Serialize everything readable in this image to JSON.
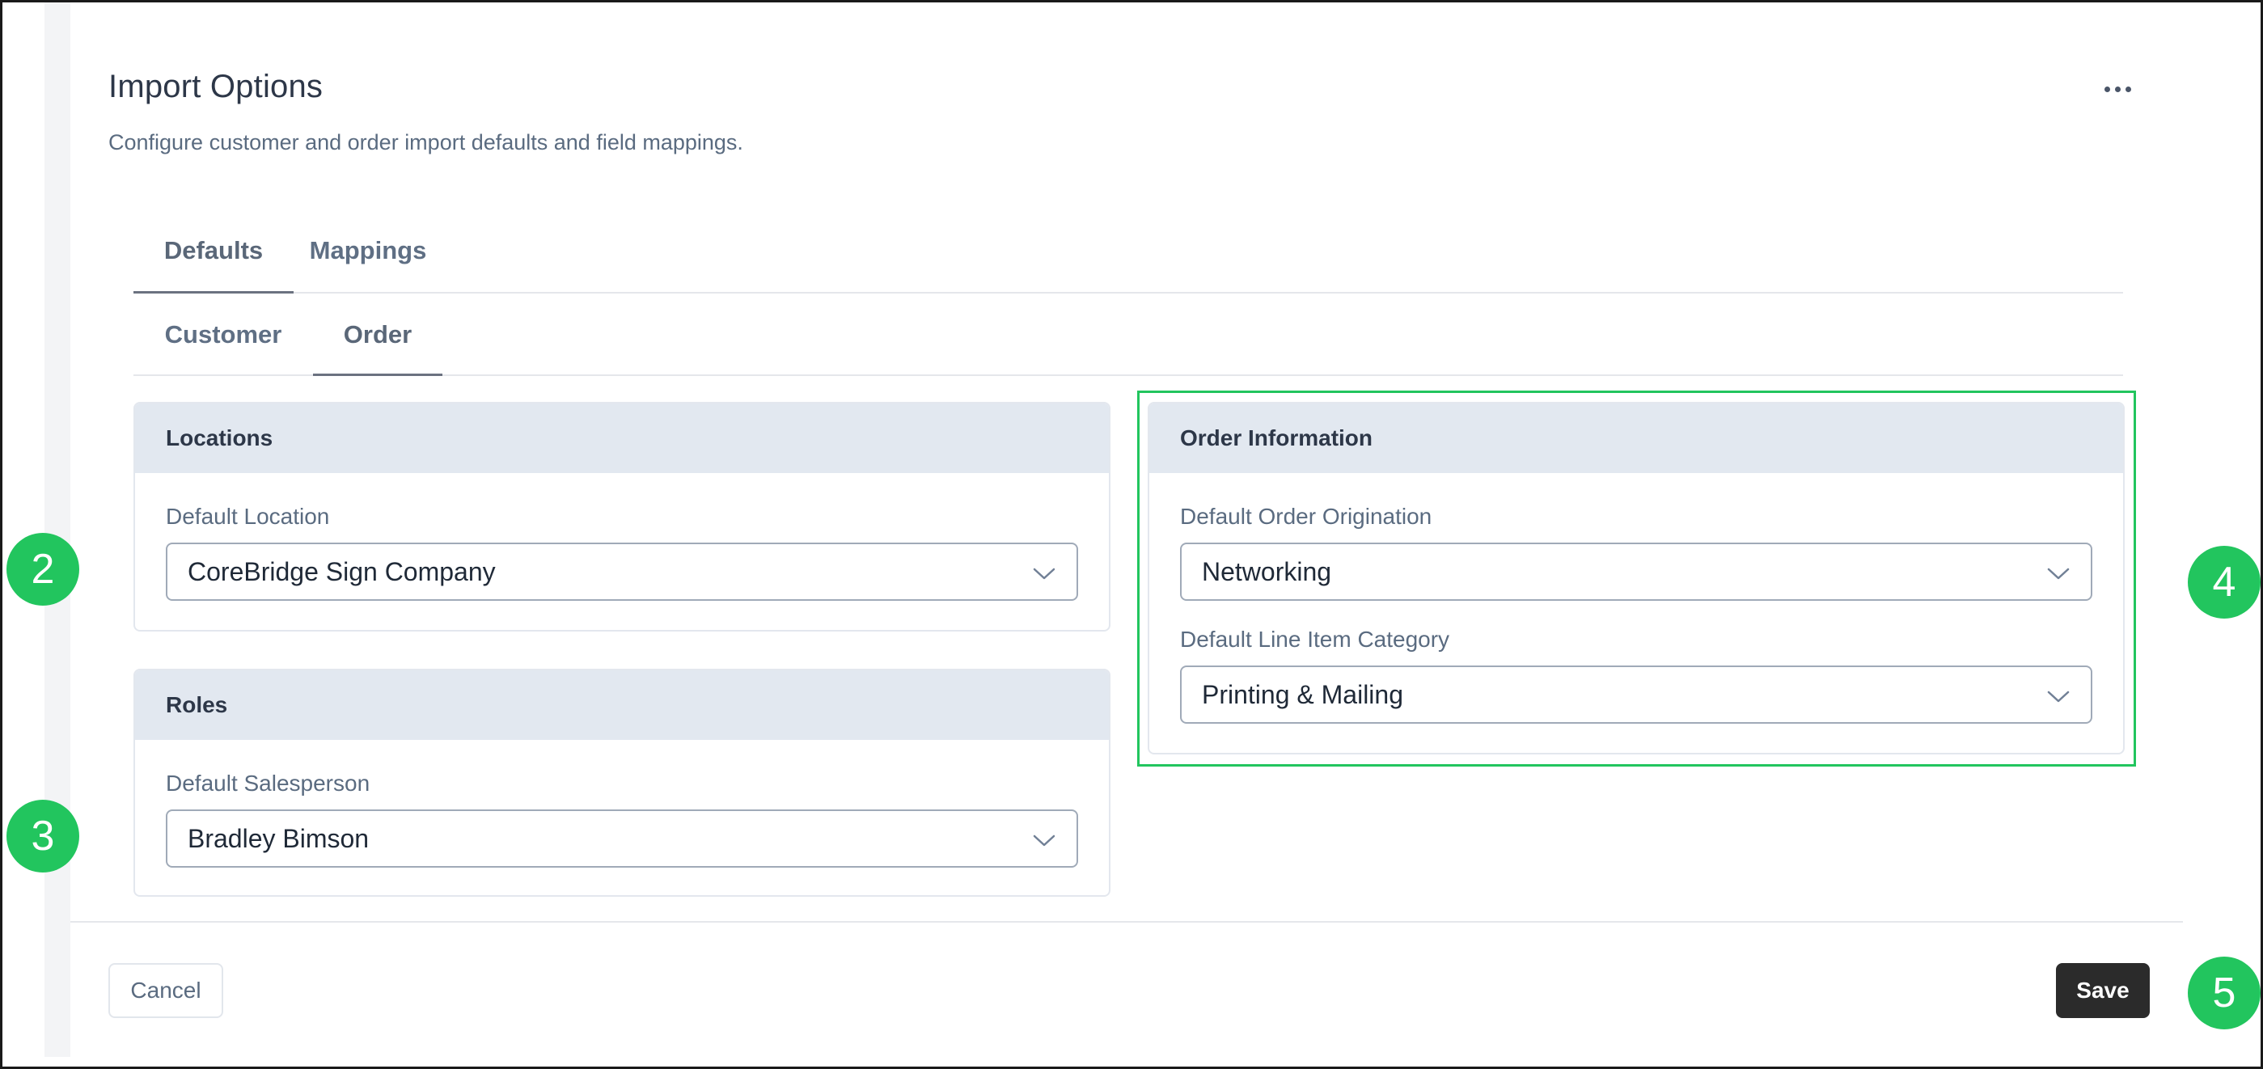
{
  "page": {
    "title": "Import Options",
    "subtitle": "Configure customer and order import defaults and field mappings."
  },
  "tabs_primary": [
    "Defaults",
    "Mappings"
  ],
  "tabs_secondary": [
    "Customer",
    "Order"
  ],
  "active_tabs": {
    "primary": "Defaults",
    "secondary": "Order"
  },
  "locations": {
    "header": "Locations",
    "default_location_label": "Default Location",
    "default_location_value": "CoreBridge Sign Company"
  },
  "roles": {
    "header": "Roles",
    "default_salesperson_label": "Default Salesperson",
    "default_salesperson_value": "Bradley Bimson"
  },
  "order_information": {
    "header": "Order Information",
    "origination_label": "Default Order Origination",
    "origination_value": "Networking",
    "category_label": "Default Line Item Category",
    "category_value": "Printing & Mailing"
  },
  "footer": {
    "cancel_label": "Cancel",
    "save_label": "Save"
  },
  "callouts": [
    "2",
    "3",
    "4",
    "5"
  ],
  "icons": {
    "more": "more-horizontal-icon",
    "dropdown": "chevron-down-icon"
  },
  "colors": {
    "callout": "#22c55e",
    "highlight_border": "#22c55e",
    "card_header": "#e2e8f0",
    "save_button": "#2b2b2b"
  }
}
